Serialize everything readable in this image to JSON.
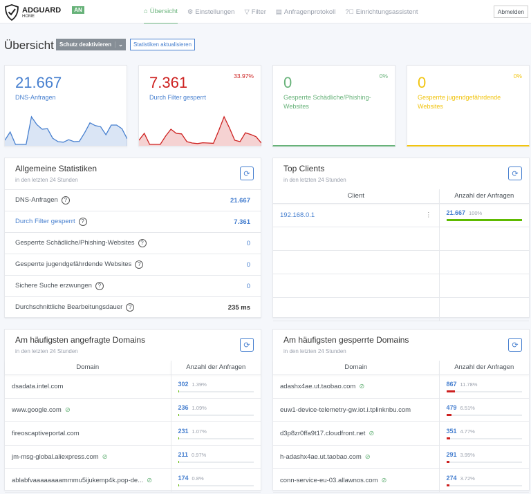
{
  "header": {
    "logo_title": "ADGUARD",
    "logo_sub": "HOME",
    "status_badge": "AN",
    "nav": [
      {
        "label": "Übersicht",
        "icon": "home-icon",
        "active": true
      },
      {
        "label": "Einstellungen",
        "icon": "gear-icon"
      },
      {
        "label": "Filter",
        "icon": "filter-icon"
      },
      {
        "label": "Anfragenprotokoll",
        "icon": "document-icon"
      },
      {
        "label": "Einrichtungsassistent",
        "icon": "help-circle-icon"
      }
    ],
    "logout": "Abmelden"
  },
  "page": {
    "title": "Übersicht",
    "disable_protection": "Schutz deaktivieren",
    "refresh_stats": "Statistiken aktualisieren"
  },
  "colors": {
    "blue": "#467fcf",
    "red": "#cd201f",
    "green": "#67b279",
    "yellow": "#f1c40f"
  },
  "cards": [
    {
      "value": "21.667",
      "label": "DNS-Anfragen",
      "percent": "",
      "color": "#467fcf",
      "sparkline": [
        0.15,
        0.45,
        0,
        0,
        0,
        1,
        0.72,
        0.55,
        0.57,
        0.22,
        0.1,
        0.08,
        0.17,
        0.1,
        0.11,
        0.42,
        0.78,
        0.68,
        0.64,
        0.35,
        0.7,
        0.7,
        0.57,
        0.2
      ]
    },
    {
      "value": "7.361",
      "label": "Durch Filter gesperrt",
      "percent": "33.97%",
      "color": "#cd201f",
      "sparkline": [
        0.15,
        0.4,
        0,
        0,
        0,
        0.3,
        0.55,
        0.4,
        0.38,
        0.1,
        0.05,
        0.03,
        0.06,
        0.05,
        0.04,
        0.5,
        1,
        0.6,
        0.15,
        0.1,
        0.42,
        0.36,
        0.28,
        0.05
      ]
    },
    {
      "value": "0",
      "label": "Gesperrte Schädliche/Phishing-Websites",
      "percent": "0%",
      "color": "#67b279"
    },
    {
      "value": "0",
      "label": "Gesperrte jugendgefährdende Websites",
      "percent": "0%",
      "color": "#f1c40f"
    }
  ],
  "general": {
    "title": "Allgemeine Statistiken",
    "subtitle": "in den letzten 24 Stunden",
    "rows": [
      {
        "label": "DNS-Anfragen",
        "value": "21.667"
      },
      {
        "label": "Durch Filter gesperrt",
        "value": "7.361"
      },
      {
        "label": "Gesperrte Schädliche/Phishing-Websites",
        "value": "0"
      },
      {
        "label": "Gesperrte jugendgefährdende Websites",
        "value": "0"
      },
      {
        "label": "Sichere Suche erzwungen",
        "value": "0"
      },
      {
        "label": "Durchschnittliche Bearbeitungsdauer",
        "value": "235 ms"
      }
    ]
  },
  "clients": {
    "title": "Top Clients",
    "subtitle": "in den letzten 24 Stunden",
    "col1": "Client",
    "col2": "Anzahl der Anfragen",
    "rows": [
      {
        "client": "192.168.0.1",
        "count": "21.667",
        "percent": "100%",
        "fill": 100
      }
    ]
  },
  "queried": {
    "title": "Am häufigsten angefragte Domains",
    "subtitle": "in den letzten 24 Stunden",
    "col1": "Domain",
    "col2": "Anzahl der Anfragen",
    "rows": [
      {
        "domain": "dsadata.intel.com",
        "count": "302",
        "percent": "1.39%",
        "fill": 1.39,
        "tracker": false
      },
      {
        "domain": "www.google.com",
        "count": "236",
        "percent": "1.09%",
        "fill": 1.09,
        "tracker": true
      },
      {
        "domain": "fireoscaptiveportal.com",
        "count": "231",
        "percent": "1.07%",
        "fill": 1.07,
        "tracker": false
      },
      {
        "domain": "jm-msg-global.aliexpress.com",
        "count": "211",
        "percent": "0.97%",
        "fill": 0.97,
        "tracker": true
      },
      {
        "domain": "ablabfvaaaaaaaammmu5ijukemp4k.pop-de...",
        "count": "174",
        "percent": "0.8%",
        "fill": 0.8,
        "tracker": true
      }
    ]
  },
  "blocked": {
    "title": "Am häufigsten gesperrte Domains",
    "subtitle": "in den letzten 24 Stunden",
    "col1": "Domain",
    "col2": "Anzahl der Anfragen",
    "rows": [
      {
        "domain": "adashx4ae.ut.taobao.com",
        "count": "867",
        "percent": "11.78%",
        "fill": 11.78,
        "tracker": true
      },
      {
        "domain": "euw1-device-telemetry-gw.iot.i.tplinknbu.com",
        "count": "479",
        "percent": "6.51%",
        "fill": 6.51,
        "tracker": false
      },
      {
        "domain": "d3p8zr0ffa9t17.cloudfront.net",
        "count": "351",
        "percent": "4.77%",
        "fill": 4.77,
        "tracker": true
      },
      {
        "domain": "h-adashx4ae.ut.taobao.com",
        "count": "291",
        "percent": "3.95%",
        "fill": 3.95,
        "tracker": true
      },
      {
        "domain": "conn-service-eu-03.allawnos.com",
        "count": "274",
        "percent": "3.72%",
        "fill": 3.72,
        "tracker": true
      }
    ]
  }
}
